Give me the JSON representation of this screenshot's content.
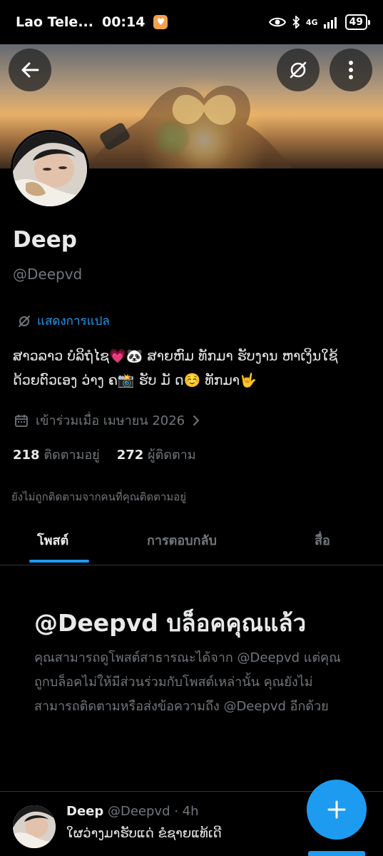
{
  "status_bar": {
    "carrier": "Lao Tele...",
    "time": "00:14",
    "network": "4G",
    "battery": "49"
  },
  "profile": {
    "name": "Deep",
    "handle": "@Deepvd",
    "translate_label": "แสดงการแปล",
    "bio_line1": "ສາວລາວ ບໍລິຖໍໄຊ💗🐼 ສາຍຫົມ ທັກມາ ຮັບງານ ຫາເງິນໃຊ້",
    "bio_line2": "ດ້ວຍຕົວເອງ ວ່າງ ຄ📸 ຮັບ ມັ ດ☺️ ທັກມາ🤟",
    "joined": "เข้าร่วมเมื่อ เมษายน 2026",
    "following_count": "218",
    "following_label": "ติดตามอยู่",
    "followers_count": "272",
    "followers_label": "ผู้ติดตาม",
    "not_followed_text": "ยังไม่ถูกติดตามจากคนที่คุณติดตามอยู่"
  },
  "tabs": [
    {
      "label": "โพสต์",
      "active": true
    },
    {
      "label": "การตอบกลับ",
      "active": false
    },
    {
      "label": "สื่อ",
      "active": false
    }
  ],
  "blocked": {
    "title": "@Deepvd บล็อคคุณแล้ว",
    "description": "คุณสามารถดูโพสต์สาธารณะได้จาก @Deepvd แต่คุณถูกบล็อคไม่ให้มีส่วนร่วมกับโพสต์เหล่านั้น คุณยังไม่สามารถติดตามหรือส่งข้อความถึง @Deepvd อีกด้วย"
  },
  "post": {
    "name": "Deep",
    "meta": "@Deepvd · 4h",
    "text": "ໃຜວ່າງມາຮັບແດ່ ຂໍຊາຍແທ້ເດີ"
  },
  "icons": {
    "back": "back-arrow-icon",
    "translate": "translate-icon",
    "more": "more-vertical-icon",
    "calendar": "calendar-icon",
    "chevron": "chevron-right-icon",
    "compose": "plus-icon"
  },
  "colors": {
    "accent": "#1d9bf0",
    "background": "#000000",
    "secondary_text": "#71767b"
  }
}
